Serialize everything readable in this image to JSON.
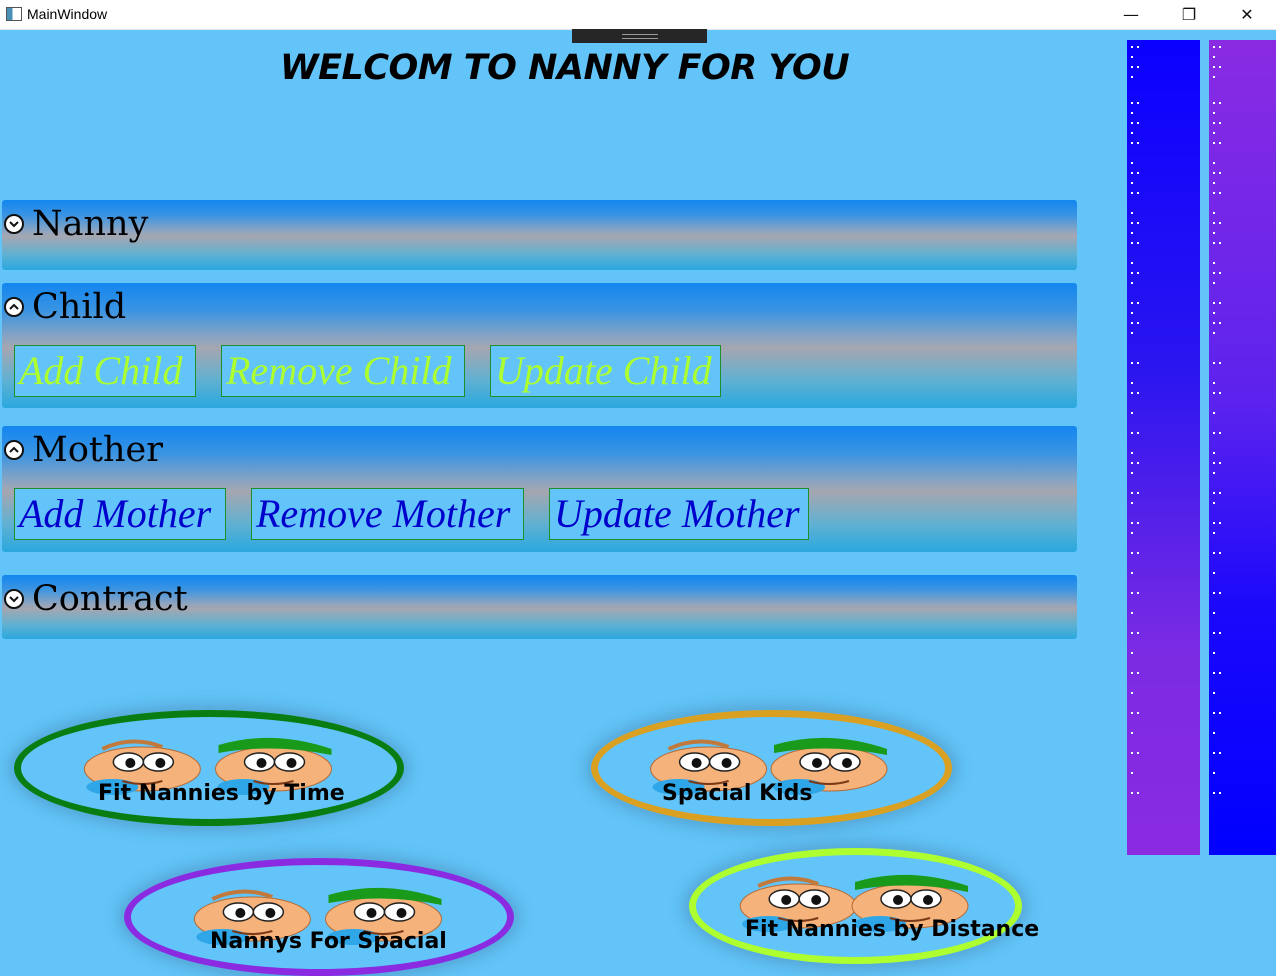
{
  "window": {
    "title": "MainWindow",
    "minimize": "—",
    "maximize": "❐",
    "close": "✕"
  },
  "welcome": "WELCOM TO NANNY FOR YOU!",
  "panels": {
    "nanny": {
      "title": "Nanny",
      "expanded": false
    },
    "child": {
      "title": "Child",
      "expanded": true,
      "buttons": [
        "Add Child",
        "Remove Child",
        "Update Child"
      ]
    },
    "mother": {
      "title": "Mother",
      "expanded": true,
      "buttons": [
        "Add Mother",
        "Remove Mother",
        "Update Mother"
      ]
    },
    "contract": {
      "title": "Contract",
      "expanded": false
    }
  },
  "image_buttons": [
    {
      "label": "Fit Nannies by Time",
      "border_color": "#0a7d12"
    },
    {
      "label": "Spacial Kids",
      "border_color": "#d9a021"
    },
    {
      "label": "Nannys For Spacial",
      "border_color": "#8a2be2"
    },
    {
      "label": "Fit Nannies by Distance",
      "border_color": "#adff2f"
    }
  ],
  "colors": {
    "background": "#62c4f8",
    "child_button_text": "#adff2f",
    "mother_button_text": "#0000cc"
  }
}
